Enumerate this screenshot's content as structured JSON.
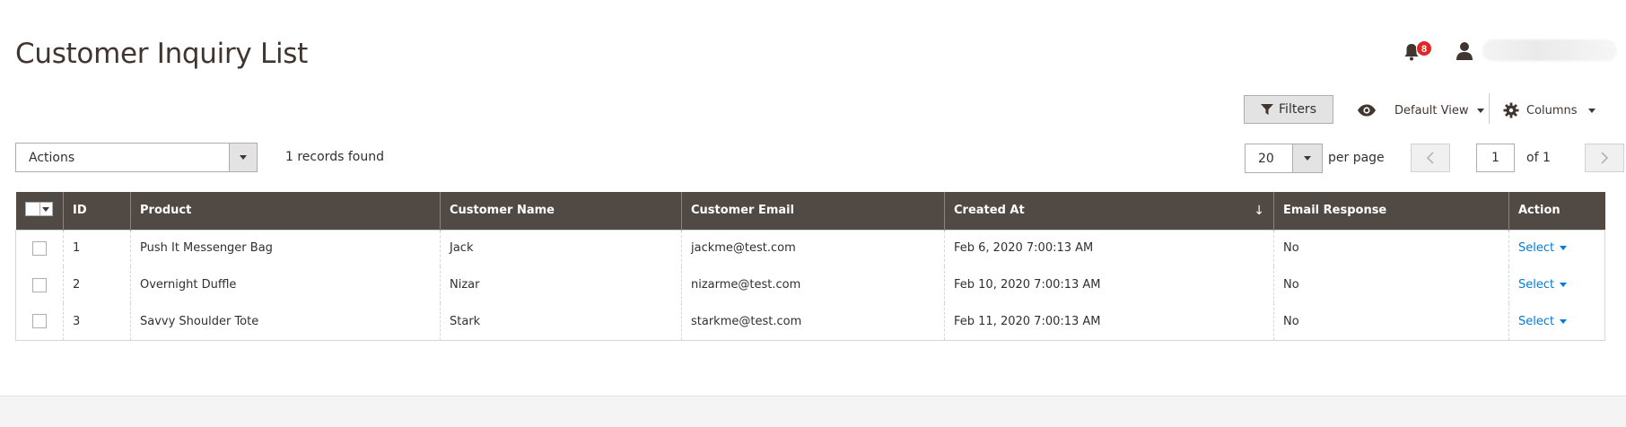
{
  "page": {
    "title": "Customer Inquiry List"
  },
  "header": {
    "notification_count": "8",
    "user_name": "admin"
  },
  "toolbar": {
    "filters_label": "Filters",
    "view_label": "Default View",
    "columns_label": "Columns",
    "actions_label": "Actions",
    "records_found": "1 records found",
    "per_page_value": "20",
    "per_page_label": "per page",
    "current_page": "1",
    "page_of": "of 1"
  },
  "grid": {
    "columns": [
      "ID",
      "Product",
      "Customer Name",
      "Customer Email",
      "Created At",
      "Email Response",
      "Action"
    ],
    "sort_indicator": "↓",
    "rows": [
      {
        "id": "1",
        "product": "Push It Messenger Bag",
        "name": "Jack",
        "email": "jackme@test.com",
        "created": "Feb 6, 2020 7:00:13 AM",
        "response": "No",
        "action": "Select"
      },
      {
        "id": "2",
        "product": "Overnight Duffle",
        "name": "Nizar",
        "email": "nizarme@test.com",
        "created": "Feb 10, 2020 7:00:13 AM",
        "response": "No",
        "action": "Select"
      },
      {
        "id": "3",
        "product": "Savvy Shoulder Tote",
        "name": "Stark",
        "email": "starkme@test.com",
        "created": "Feb 11, 2020 7:00:13 AM",
        "response": "No",
        "action": "Select"
      }
    ]
  },
  "colors": {
    "header_bg": "#514943",
    "link": "#007bdb",
    "badge": "#e22626"
  },
  "icons": [
    "bell-icon",
    "user-icon",
    "filter-icon",
    "eye-icon",
    "gear-icon",
    "chevron-left-icon",
    "chevron-right-icon"
  ]
}
